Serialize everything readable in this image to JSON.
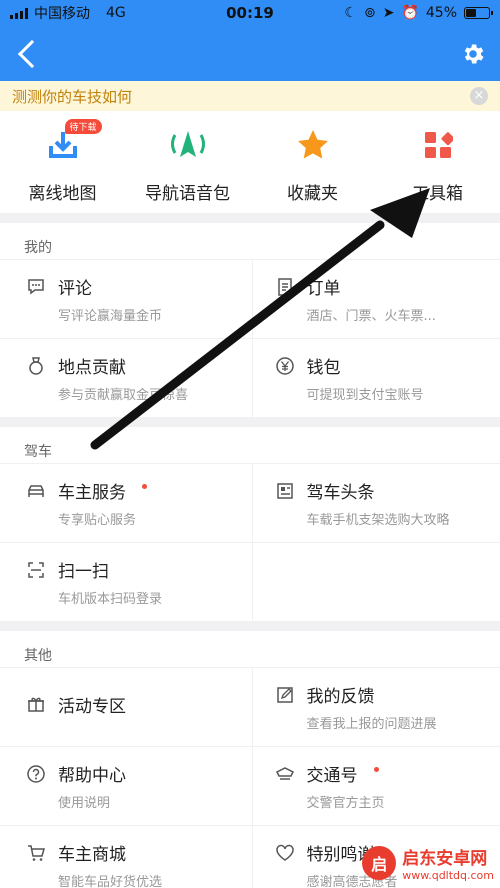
{
  "status_bar": {
    "carrier": "中国移动",
    "network": "4G",
    "time": "00:19",
    "battery": "45%",
    "battery_level": 0.45
  },
  "nav": {
    "back_icon": "back-arrow-icon",
    "settings_icon": "gear-icon"
  },
  "banner": {
    "text": "测测你的车技如何",
    "close": "×"
  },
  "quick_actions": [
    {
      "label": "离线地图",
      "icon": "download-icon",
      "badge": "待下载"
    },
    {
      "label": "导航语音包",
      "icon": "voice-navigation-icon"
    },
    {
      "label": "收藏夹",
      "icon": "star-icon"
    },
    {
      "label": "工具箱",
      "icon": "toolbox-icon"
    }
  ],
  "sections": {
    "mine": {
      "title": "我的",
      "items": [
        {
          "title": "评论",
          "sub": "写评论赢海量金币"
        },
        {
          "title": "订单",
          "sub": "酒店、门票、火车票..."
        },
        {
          "title": "地点贡献",
          "sub": "参与贡献赢取金豆惊喜"
        },
        {
          "title": "钱包",
          "sub": "可提现到支付宝账号"
        }
      ]
    },
    "driving": {
      "title": "驾车",
      "items": [
        {
          "title": "车主服务",
          "sub": "专享贴心服务"
        },
        {
          "title": "驾车头条",
          "sub": "车载手机支架选购大攻略"
        },
        {
          "title": "扫一扫",
          "sub": "车机版本扫码登录"
        }
      ]
    },
    "other": {
      "title": "其他",
      "items": [
        {
          "title": "活动专区",
          "sub": ""
        },
        {
          "title": "我的反馈",
          "sub": "查看我上报的问题进展"
        },
        {
          "title": "帮助中心",
          "sub": "使用说明"
        },
        {
          "title": "交通号",
          "sub": "交警官方主页"
        },
        {
          "title": "车主商城",
          "sub": "智能车品好货优选"
        },
        {
          "title": "特别鸣谢",
          "sub": "感谢高德志愿者"
        }
      ]
    }
  },
  "watermark": {
    "title": "启东安卓网",
    "url": "www.qdltdq.com"
  },
  "colors": {
    "primary": "#2f8df5",
    "banner_text": "#c2820e",
    "badge": "#f44b3b",
    "green": "#21b37a",
    "orange": "#f7981d",
    "red": "#f0584a"
  }
}
